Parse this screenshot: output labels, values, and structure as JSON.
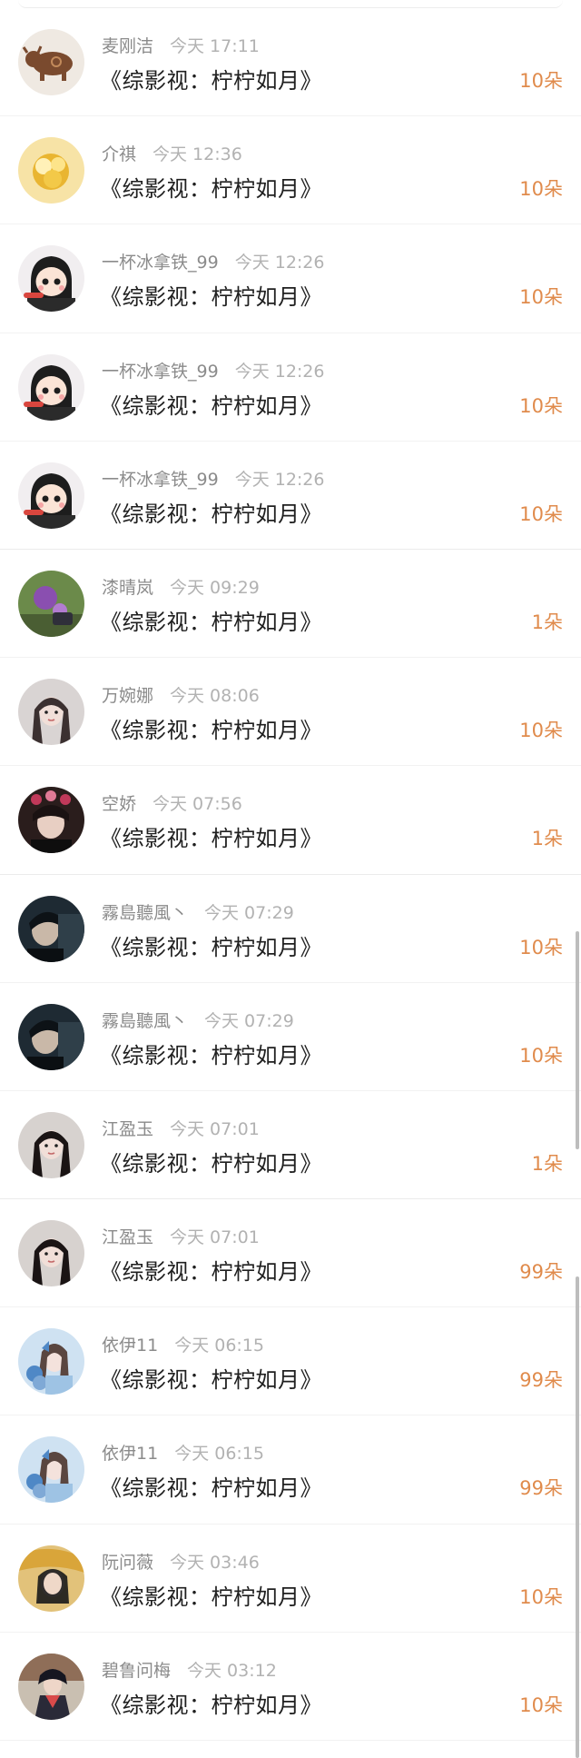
{
  "rows": [
    {
      "user": "麦刚洁",
      "time": "今天 17:11",
      "title": "《综影视：柠柠如月》",
      "amount": "10朵",
      "avatar": "bull-figurine-icon",
      "bg": "#efe9e2",
      "fg": "#7a4a2e"
    },
    {
      "user": "介祺",
      "time": "今天 12:36",
      "title": "《综影视：柠柠如月》",
      "amount": "10朵",
      "avatar": "yellow-flower-icon",
      "bg": "#f7e3a6",
      "fg": "#e9b531"
    },
    {
      "user": "一杯冰拿铁_99",
      "time": "今天 12:26",
      "title": "《综影视：柠柠如月》",
      "amount": "10朵",
      "avatar": "cartoon-girl-icon",
      "bg": "#f1eef0",
      "fg": "#1d1d1d"
    },
    {
      "user": "一杯冰拿铁_99",
      "time": "今天 12:26",
      "title": "《综影视：柠柠如月》",
      "amount": "10朵",
      "avatar": "cartoon-girl-icon",
      "bg": "#f1eef0",
      "fg": "#1d1d1d"
    },
    {
      "user": "一杯冰拿铁_99",
      "time": "今天 12:26",
      "title": "《综影视：柠柠如月》",
      "amount": "10朵",
      "avatar": "cartoon-girl-icon",
      "bg": "#f1eef0",
      "fg": "#1d1d1d"
    },
    {
      "user": "漆晴岚",
      "time": "今天 09:29",
      "title": "《综影视：柠柠如月》",
      "amount": "1朵",
      "avatar": "purple-flower-icon",
      "bg": "#6b8a4a",
      "fg": "#8a4fb0"
    },
    {
      "user": "万婉娜",
      "time": "今天 08:06",
      "title": "《综影视：柠柠如月》",
      "amount": "10朵",
      "avatar": "portrait-icon",
      "bg": "#d9d4d3",
      "fg": "#3b3030"
    },
    {
      "user": "空娇",
      "time": "今天 07:56",
      "title": "《综影视：柠柠如月》",
      "amount": "1朵",
      "avatar": "portrait-flowers-icon",
      "bg": "#2a1d1c",
      "fg": "#c0395a"
    },
    {
      "user": "霧島聽風丶",
      "time": "今天 07:29",
      "title": "《综影视：柠柠如月》",
      "amount": "10朵",
      "avatar": "portrait-dark-icon",
      "bg": "#1e2a33",
      "fg": "#c9b8a8"
    },
    {
      "user": "霧島聽風丶",
      "time": "今天 07:29",
      "title": "《综影视：柠柠如月》",
      "amount": "10朵",
      "avatar": "portrait-dark-icon",
      "bg": "#1e2a33",
      "fg": "#c9b8a8"
    },
    {
      "user": "江盈玉",
      "time": "今天 07:01",
      "title": "《综影视：柠柠如月》",
      "amount": "1朵",
      "avatar": "portrait-icon",
      "bg": "#d7d2cf",
      "fg": "#1a1414"
    },
    {
      "user": "江盈玉",
      "time": "今天 07:01",
      "title": "《综影视：柠柠如月》",
      "amount": "99朵",
      "avatar": "portrait-icon",
      "bg": "#d7d2cf",
      "fg": "#1a1414"
    },
    {
      "user": "依伊11",
      "time": "今天 06:15",
      "title": "《综影视：柠柠如月》",
      "amount": "99朵",
      "avatar": "portrait-blue-icon",
      "bg": "#cfe2f2",
      "fg": "#4f88c6"
    },
    {
      "user": "依伊11",
      "time": "今天 06:15",
      "title": "《综影视：柠柠如月》",
      "amount": "99朵",
      "avatar": "portrait-blue-icon",
      "bg": "#cfe2f2",
      "fg": "#4f88c6"
    },
    {
      "user": "阮问薇",
      "time": "今天 03:46",
      "title": "《综影视：柠柠如月》",
      "amount": "10朵",
      "avatar": "portrait-yellow-icon",
      "bg": "#e2c27a",
      "fg": "#1a1a1a"
    },
    {
      "user": "碧鲁问梅",
      "time": "今天 03:12",
      "title": "《综影视：柠柠如月》",
      "amount": "10朵",
      "avatar": "portrait-costume-icon",
      "bg": "#c9bfb1",
      "fg": "#2a2a38"
    }
  ]
}
